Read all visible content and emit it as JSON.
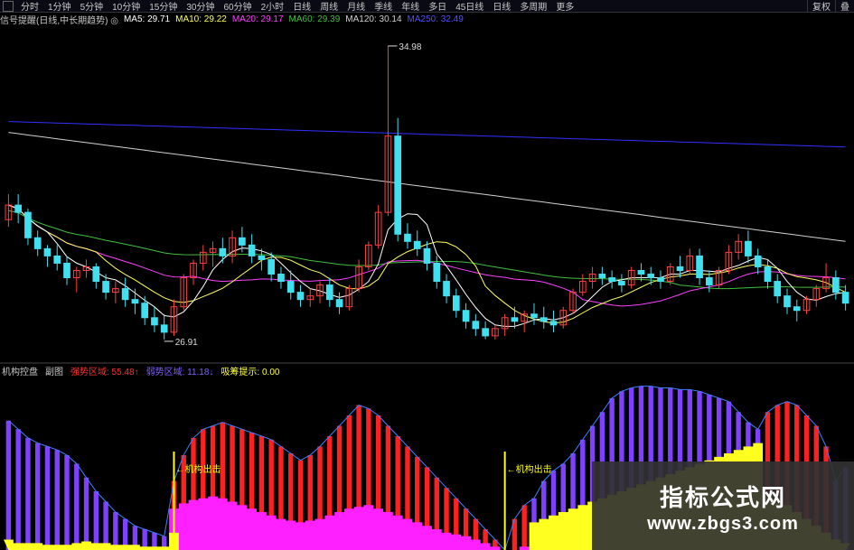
{
  "toolbar": {
    "periods": [
      "分时",
      "1分钟",
      "5分钟",
      "10分钟",
      "15分钟",
      "30分钟",
      "60分钟",
      "2小时",
      "日线",
      "周线",
      "月线",
      "季线",
      "年线",
      "多日",
      "45日线",
      "日线",
      "多周期",
      "更多"
    ],
    "right_items": [
      "复权",
      "叠"
    ]
  },
  "ma_legend": {
    "title": "信号提醒(日线,中长期趋势) ◎",
    "ma5": "MA5: 29.71",
    "ma10": "MA10: 29.22",
    "ma20": "MA20: 29.17",
    "ma60": "MA60: 29.39",
    "ma120": "MA120: 30.14",
    "ma250": "MA250: 32.49"
  },
  "indicator_legend": {
    "name": "机构控盘",
    "sub": "副图",
    "v1": "强势区域: 55.48↑",
    "v2": "弱势区域: 11.18↓",
    "v3": "吸筹提示: 0.00"
  },
  "annotations": {
    "high": "34.98",
    "low": "26.91",
    "signal": "机构出击"
  },
  "watermark": {
    "title": "指标公式网",
    "url": "www.zbgs3.com"
  },
  "colors": {
    "up": "#ff4040",
    "down": "#40e0f0",
    "ma5": "#ffffff",
    "ma10": "#ffff60",
    "ma20": "#ff40ff",
    "ma60": "#40c040",
    "ma120": "#d0d0d0",
    "ma250": "#3030ff",
    "strong": "#ff2020",
    "weak": "#8040ff",
    "fill_magenta": "#ff20ff",
    "fill_yellow": "#ffff20",
    "signal": "#ffff00"
  },
  "chart_data": {
    "type": "candlestick",
    "price_range": [
      26.5,
      35.5
    ],
    "candles": [
      [
        30.2,
        30.9,
        30.0,
        30.6
      ],
      [
        30.6,
        30.9,
        30.1,
        30.4
      ],
      [
        30.4,
        30.5,
        29.5,
        29.7
      ],
      [
        29.7,
        29.9,
        29.2,
        29.4
      ],
      [
        29.4,
        29.5,
        28.9,
        29.2
      ],
      [
        29.2,
        29.5,
        28.8,
        29.0
      ],
      [
        29.0,
        29.2,
        28.4,
        28.6
      ],
      [
        28.6,
        28.9,
        28.2,
        28.8
      ],
      [
        28.8,
        29.1,
        28.6,
        28.9
      ],
      [
        28.9,
        29.0,
        28.3,
        28.5
      ],
      [
        28.5,
        28.7,
        28.0,
        28.2
      ],
      [
        28.2,
        28.5,
        27.9,
        28.3
      ],
      [
        28.3,
        28.6,
        27.8,
        28.0
      ],
      [
        28.0,
        28.3,
        27.6,
        27.9
      ],
      [
        27.9,
        28.1,
        27.3,
        27.5
      ],
      [
        27.5,
        27.8,
        27.1,
        27.3
      ],
      [
        27.3,
        27.6,
        26.9,
        27.1
      ],
      [
        27.1,
        28.0,
        27.0,
        27.8
      ],
      [
        27.8,
        28.7,
        27.7,
        28.6
      ],
      [
        28.6,
        29.1,
        28.4,
        29.0
      ],
      [
        29.0,
        29.5,
        28.8,
        29.3
      ],
      [
        29.3,
        29.6,
        28.9,
        29.4
      ],
      [
        29.4,
        29.7,
        29.0,
        29.2
      ],
      [
        29.2,
        29.9,
        29.0,
        29.7
      ],
      [
        29.7,
        30.0,
        29.3,
        29.5
      ],
      [
        29.5,
        29.8,
        29.0,
        29.2
      ],
      [
        29.2,
        29.4,
        28.8,
        29.1
      ],
      [
        29.1,
        29.3,
        28.5,
        28.7
      ],
      [
        28.7,
        28.9,
        28.3,
        28.5
      ],
      [
        28.5,
        28.8,
        28.0,
        28.2
      ],
      [
        28.2,
        28.4,
        27.8,
        28.0
      ],
      [
        28.0,
        28.3,
        27.8,
        28.1
      ],
      [
        28.1,
        28.5,
        27.9,
        28.4
      ],
      [
        28.4,
        28.6,
        27.8,
        28.0
      ],
      [
        28.0,
        28.2,
        27.6,
        27.8
      ],
      [
        27.8,
        28.4,
        27.7,
        28.3
      ],
      [
        28.3,
        29.1,
        28.2,
        28.9
      ],
      [
        28.9,
        29.6,
        28.8,
        29.5
      ],
      [
        29.5,
        30.6,
        29.4,
        30.4
      ],
      [
        30.4,
        34.98,
        30.3,
        32.5
      ],
      [
        32.5,
        33.0,
        29.6,
        29.8
      ],
      [
        29.8,
        30.1,
        29.4,
        29.6
      ],
      [
        29.6,
        29.9,
        29.2,
        29.4
      ],
      [
        29.4,
        29.6,
        28.8,
        29.0
      ],
      [
        29.0,
        29.2,
        28.3,
        28.5
      ],
      [
        28.5,
        28.7,
        27.9,
        28.1
      ],
      [
        28.1,
        28.3,
        27.5,
        27.7
      ],
      [
        27.7,
        27.9,
        27.2,
        27.4
      ],
      [
        27.4,
        27.6,
        27.0,
        27.2
      ],
      [
        27.2,
        27.4,
        26.91,
        27.0
      ],
      [
        27.0,
        27.3,
        26.9,
        27.2
      ],
      [
        27.2,
        27.6,
        27.0,
        27.5
      ],
      [
        27.5,
        27.8,
        27.2,
        27.4
      ],
      [
        27.4,
        27.7,
        27.1,
        27.6
      ],
      [
        27.6,
        27.9,
        27.3,
        27.5
      ],
      [
        27.5,
        27.8,
        27.2,
        27.4
      ],
      [
        27.4,
        27.7,
        27.1,
        27.3
      ],
      [
        27.3,
        27.8,
        27.2,
        27.7
      ],
      [
        27.7,
        28.3,
        27.6,
        28.2
      ],
      [
        28.2,
        28.7,
        28.1,
        28.5
      ],
      [
        28.5,
        28.9,
        28.3,
        28.7
      ],
      [
        28.7,
        28.9,
        28.4,
        28.6
      ],
      [
        28.6,
        28.8,
        28.3,
        28.5
      ],
      [
        28.5,
        28.7,
        28.2,
        28.4
      ],
      [
        28.4,
        28.9,
        28.3,
        28.8
      ],
      [
        28.8,
        29.0,
        28.5,
        28.7
      ],
      [
        28.7,
        28.9,
        28.4,
        28.6
      ],
      [
        28.6,
        28.8,
        28.3,
        28.5
      ],
      [
        28.5,
        29.0,
        28.4,
        28.9
      ],
      [
        28.9,
        29.2,
        28.6,
        28.8
      ],
      [
        28.8,
        29.4,
        28.7,
        29.2
      ],
      [
        29.2,
        29.4,
        28.4,
        28.6
      ],
      [
        28.6,
        28.8,
        28.2,
        28.4
      ],
      [
        28.4,
        28.9,
        28.3,
        28.8
      ],
      [
        28.8,
        29.5,
        28.7,
        29.3
      ],
      [
        29.3,
        29.8,
        29.1,
        29.6
      ],
      [
        29.6,
        29.9,
        29.0,
        29.2
      ],
      [
        29.2,
        29.4,
        28.7,
        28.9
      ],
      [
        28.9,
        29.1,
        28.3,
        28.5
      ],
      [
        28.5,
        28.7,
        27.9,
        28.1
      ],
      [
        28.1,
        28.3,
        27.6,
        27.8
      ],
      [
        27.8,
        28.0,
        27.4,
        27.7
      ],
      [
        27.7,
        28.1,
        27.6,
        28.0
      ],
      [
        28.0,
        28.4,
        27.8,
        28.3
      ],
      [
        28.3,
        29.0,
        28.2,
        28.6
      ],
      [
        28.6,
        28.8,
        28.0,
        28.2
      ],
      [
        28.2,
        28.4,
        27.7,
        27.9
      ]
    ],
    "indicator": {
      "range": [
        0,
        100
      ],
      "strong": [
        0,
        0,
        0,
        0,
        0,
        0,
        0,
        0,
        0,
        0,
        0,
        0,
        0,
        0,
        0,
        0,
        0,
        40,
        55,
        65,
        70,
        72,
        74,
        72,
        70,
        68,
        66,
        64,
        60,
        56,
        52,
        55,
        60,
        66,
        72,
        78,
        84,
        82,
        78,
        72,
        66,
        60,
        54,
        48,
        42,
        36,
        30,
        24,
        18,
        12,
        6,
        0,
        18,
        26,
        0,
        0,
        0,
        0,
        0,
        0,
        0,
        0,
        0,
        0,
        0,
        0,
        0,
        0,
        0,
        0,
        0,
        0,
        0,
        0,
        0,
        0,
        0,
        0,
        80,
        84,
        86,
        84,
        78,
        72,
        60,
        0,
        0
      ],
      "weak": [
        75,
        70,
        65,
        62,
        60,
        58,
        55,
        50,
        42,
        34,
        28,
        22,
        18,
        14,
        12,
        10,
        8,
        0,
        0,
        0,
        0,
        0,
        0,
        0,
        0,
        0,
        0,
        0,
        0,
        0,
        0,
        0,
        0,
        0,
        0,
        0,
        0,
        0,
        0,
        0,
        0,
        0,
        0,
        0,
        0,
        0,
        0,
        0,
        0,
        0,
        0,
        0,
        0,
        0,
        30,
        40,
        46,
        50,
        56,
        64,
        72,
        80,
        88,
        92,
        94,
        95,
        95,
        94,
        94,
        93,
        93,
        92,
        90,
        88,
        86,
        80,
        74,
        70,
        0,
        0,
        0,
        0,
        0,
        0,
        0,
        40,
        48
      ],
      "fill_magenta": [
        0,
        0,
        0,
        0,
        0,
        0,
        0,
        0,
        0,
        0,
        0,
        0,
        0,
        0,
        0,
        0,
        0,
        24,
        27,
        29,
        30,
        31,
        30,
        28,
        26,
        24,
        22,
        20,
        18,
        17,
        16,
        17,
        18,
        20,
        22,
        24,
        25,
        26,
        24,
        22,
        20,
        18,
        16,
        14,
        12,
        10,
        9,
        8,
        6,
        4,
        2,
        0,
        0,
        2,
        0,
        0,
        0,
        0,
        0,
        0,
        0,
        0,
        0,
        0,
        0,
        0,
        0,
        0,
        0,
        0,
        0,
        0,
        0,
        0,
        0,
        0,
        0,
        0,
        10,
        12,
        11,
        8,
        6,
        4,
        2,
        0,
        0
      ],
      "fill_yellow": [
        6,
        4,
        4,
        4,
        3,
        3,
        3,
        4,
        5,
        4,
        4,
        3,
        3,
        3,
        2,
        2,
        2,
        10,
        0,
        0,
        0,
        0,
        0,
        0,
        0,
        0,
        0,
        0,
        0,
        0,
        0,
        0,
        0,
        0,
        0,
        0,
        0,
        0,
        0,
        0,
        0,
        0,
        0,
        0,
        0,
        0,
        0,
        0,
        0,
        0,
        0,
        0,
        0,
        0,
        16,
        18,
        20,
        22,
        24,
        26,
        28,
        30,
        32,
        34,
        36,
        38,
        40,
        42,
        44,
        46,
        48,
        50,
        52,
        54,
        56,
        58,
        60,
        62,
        32,
        30,
        26,
        22,
        18,
        14,
        10,
        6,
        4
      ],
      "signals": [
        17,
        51
      ]
    }
  }
}
